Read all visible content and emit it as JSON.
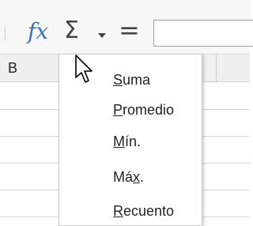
{
  "toolbar": {
    "function_wizard_label": "fx",
    "sum_symbol": "Σ",
    "formula_symbol": "=",
    "formula_value": ""
  },
  "sheet": {
    "column_header": "B"
  },
  "menu": {
    "items": [
      {
        "id": "suma",
        "accel": "S",
        "before": "",
        "after": "uma"
      },
      {
        "id": "promedio",
        "accel": "P",
        "before": "",
        "after": "romedio"
      },
      {
        "id": "min",
        "accel": "M",
        "before": "",
        "after": "ín."
      },
      {
        "id": "max",
        "accel": "x",
        "before": "Má",
        "after": "."
      },
      {
        "id": "recuento",
        "accel": "R",
        "before": "",
        "after": "ecuento"
      }
    ]
  },
  "colors": {
    "fx": "#3b6fb4",
    "toolbar_bg": "#f7f7f7",
    "menu_bg": "#ffffff"
  },
  "icons": {
    "cursor": "arrow-cursor-icon",
    "dropdown": "chevron-down-icon"
  }
}
